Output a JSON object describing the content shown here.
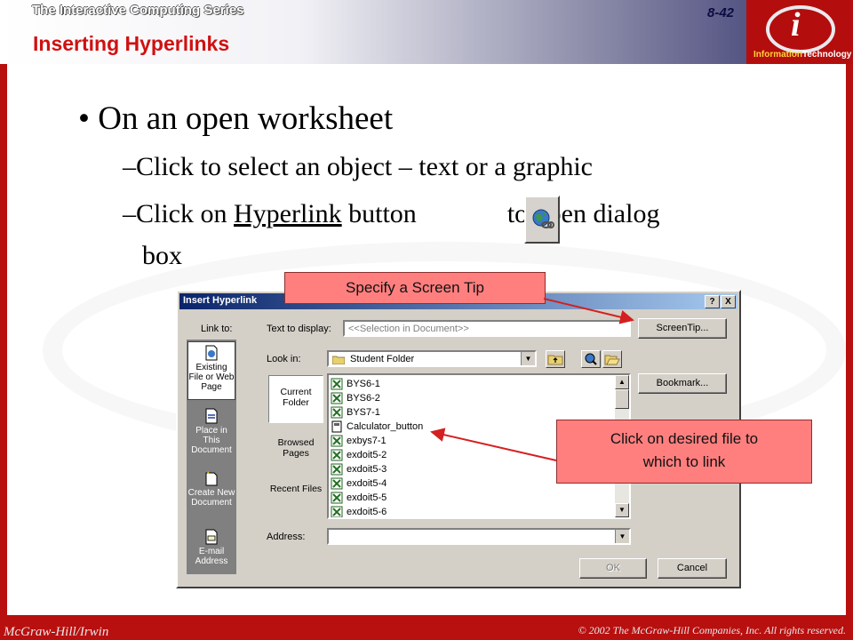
{
  "header": {
    "series": "The Interactive Computing Series",
    "slide_number": "8-42",
    "title": "Inserting Hyperlinks",
    "logo_part1": "Information",
    "logo_part2": "Technology",
    "logo_letter": "i"
  },
  "slide": {
    "bullet1": "On an open worksheet",
    "bullet_dot": "•",
    "sub1": "–Click to select an object – text or a graphic",
    "sub2_prefix": "–Click on ",
    "sub2_link": "Hyperlink",
    "sub2_mid": " button",
    "sub2_suffix": "to open dialog",
    "sub2_cont": "box"
  },
  "dialog": {
    "title": "Insert Hyperlink",
    "help_btn": "?",
    "close_btn": "X",
    "link_to_label": "Link to:",
    "text_to_display_label": "Text to display:",
    "text_to_display_value": "<<Selection in Document>>",
    "screentip_btn": "ScreenTip...",
    "look_in_label": "Look in:",
    "look_in_value": "Student Folder",
    "bookmark_btn": "Bookmark...",
    "link_options": [
      {
        "label": "Existing File or Web Page"
      },
      {
        "label": "Place in This Document"
      },
      {
        "label": "Create New Document"
      },
      {
        "label": "E-mail Address"
      }
    ],
    "folder_options": [
      {
        "label": "Current Folder"
      },
      {
        "label": "Browsed Pages"
      },
      {
        "label": "Recent Files"
      }
    ],
    "files": [
      "BYS6-1",
      "BYS6-2",
      "BYS7-1",
      "Calculator_button",
      "exbys7-1",
      "exdoit5-2",
      "exdoit5-3",
      "exdoit5-4",
      "exdoit5-5",
      "exdoit5-6"
    ],
    "address_label": "Address:",
    "address_value": "",
    "ok_btn": "OK",
    "cancel_btn": "Cancel"
  },
  "callouts": {
    "screen_tip": "Specify a Screen Tip",
    "desired_file_line1": "Click on desired file to",
    "desired_file_line2": "which to link"
  },
  "footer": {
    "publisher": "McGraw-Hill/Irwin",
    "copyright": "© 2002 The McGraw-Hill Companies, Inc. All rights reserved."
  },
  "colors": {
    "frame": "#b80f0f",
    "title": "#d01010",
    "callout": "#ff7f7f",
    "arrow": "#d42020"
  }
}
